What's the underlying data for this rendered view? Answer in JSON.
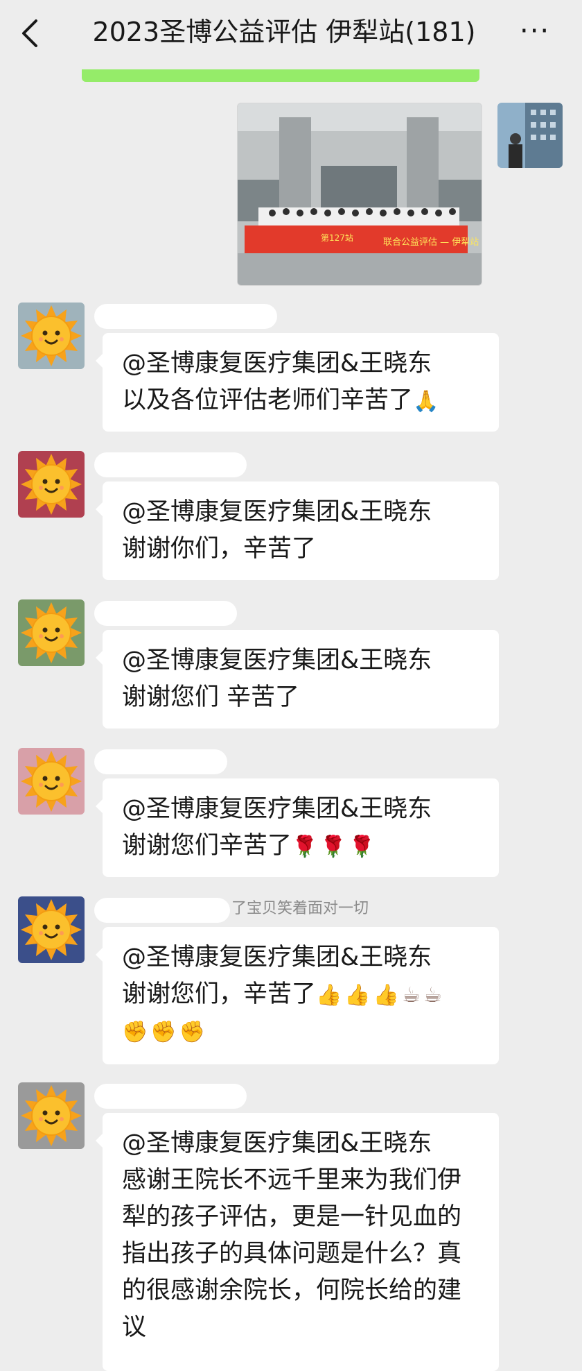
{
  "header": {
    "title": "2023圣博公益评估  伊犁站(181)",
    "more_label": "···"
  },
  "colors": {
    "background": "#ededed",
    "bubble": "#ffffff",
    "accent_green": "#95ec69"
  },
  "sent_photo": {
    "banner_text": "联合公益评估 — 伊犁站",
    "banner_sub": "第127站"
  },
  "messages": [
    {
      "lines": [
        "@圣博康复医疗集团&王晓东",
        "以及各位评估老师们辛苦了"
      ],
      "trailing_emoji": [
        "pray"
      ]
    },
    {
      "lines": [
        "@圣博康复医疗集团&王晓东",
        "谢谢你们，辛苦了"
      ],
      "trailing_emoji": []
    },
    {
      "lines": [
        "@圣博康复医疗集团&王晓东",
        "谢谢您们 辛苦了"
      ],
      "trailing_emoji": []
    },
    {
      "lines": [
        "@圣博康复医疗集团&王晓东",
        "谢谢您们辛苦了"
      ],
      "trailing_emoji": [
        "rose",
        "rose",
        "rose"
      ]
    },
    {
      "nick_partial": "了宝贝笑着面对一切",
      "lines": [
        "@圣博康复医疗集团&王晓东",
        "谢谢您们，辛苦了"
      ],
      "trailing_emoji": [
        "thumbs-up",
        "thumbs-up",
        "thumbs-up",
        "coffee",
        "coffee"
      ],
      "extra_emoji": [
        "fist",
        "fist",
        "fist"
      ]
    },
    {
      "lines": [
        "@圣博康复医疗集团&王晓东",
        "感谢王院长不远千里来为我们伊",
        "犁的孩子评估，更是一针见血的",
        "指出孩子的具体问题是什么？真",
        "的很感谢余院长，何院长给的建",
        "议"
      ],
      "trailing_emoji": []
    }
  ]
}
